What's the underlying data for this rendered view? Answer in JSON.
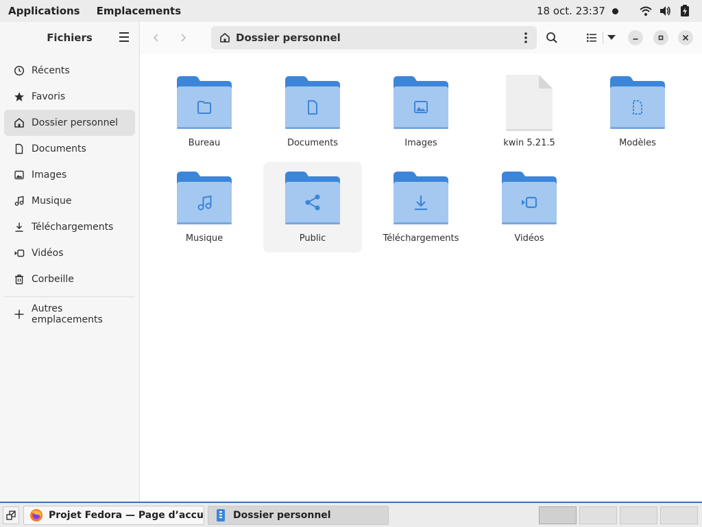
{
  "topbar": {
    "menu_applications": "Applications",
    "menu_places": "Emplacements",
    "clock": "18 oct.  23:37"
  },
  "sidebar": {
    "title": "Fichiers",
    "items": [
      {
        "label": "Récents",
        "icon": "clock-icon"
      },
      {
        "label": "Favoris",
        "icon": "star-icon"
      },
      {
        "label": "Dossier personnel",
        "icon": "home-icon",
        "active": true
      },
      {
        "label": "Documents",
        "icon": "document-icon"
      },
      {
        "label": "Images",
        "icon": "image-icon"
      },
      {
        "label": "Musique",
        "icon": "music-icon"
      },
      {
        "label": "Téléchargements",
        "icon": "download-icon"
      },
      {
        "label": "Vidéos",
        "icon": "video-icon"
      },
      {
        "label": "Corbeille",
        "icon": "trash-icon"
      }
    ],
    "other_locations": "Autres emplacements"
  },
  "header": {
    "path": "Dossier personnel"
  },
  "files": [
    {
      "label": "Bureau",
      "type": "folder",
      "emblem": "desktop"
    },
    {
      "label": "Documents",
      "type": "folder",
      "emblem": "document"
    },
    {
      "label": "Images",
      "type": "folder",
      "emblem": "image"
    },
    {
      "label": "kwin 5.21.5",
      "type": "file",
      "emblem": "none"
    },
    {
      "label": "Modèles",
      "type": "folder",
      "emblem": "template"
    },
    {
      "label": "Musique",
      "type": "folder",
      "emblem": "music"
    },
    {
      "label": "Public",
      "type": "folder",
      "emblem": "share",
      "selected": true
    },
    {
      "label": "Téléchargements",
      "type": "folder",
      "emblem": "download"
    },
    {
      "label": "Vidéos",
      "type": "folder",
      "emblem": "video"
    }
  ],
  "taskbar": {
    "task1": "Projet Fedora — Page d’accueil …",
    "task2": "Dossier personnel"
  },
  "colors": {
    "folder_top": "#3d85d8",
    "folder_body": "#a4c8ef",
    "folder_emblem": "#3d85d8",
    "accent": "#3c6fb4"
  }
}
